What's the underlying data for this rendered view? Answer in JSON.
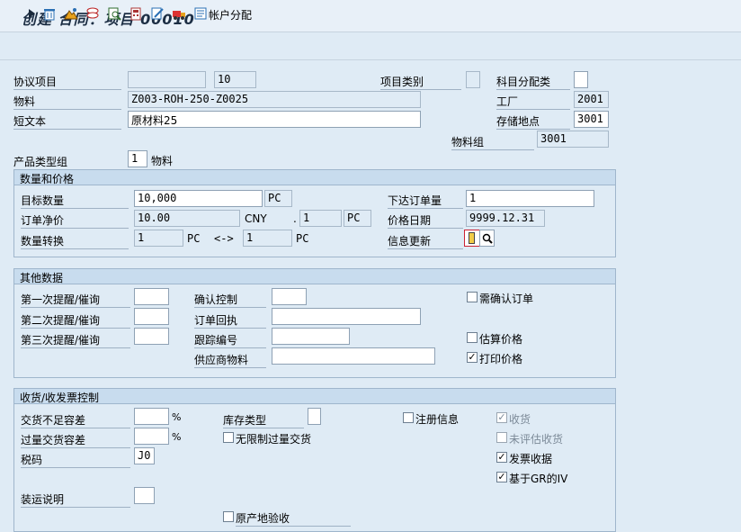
{
  "window": {
    "title": "创建 合同：项目 00010"
  },
  "toolbar": {
    "account_assign_label": "帐户分配"
  },
  "header": {
    "agreement_item_label": "协议项目",
    "agreement_item_value": "10",
    "item_category_label": "项目类别",
    "acct_assign_cat_label": "科目分配类",
    "material_label": "物料",
    "material_value": "Z003-ROH-250-Z0025",
    "plant_label": "工厂",
    "plant_value": "2001",
    "short_text_label": "短文本",
    "short_text_value": "原材料25",
    "storage_loc_label": "存储地点",
    "storage_loc_value": "3001",
    "material_group_label": "物料组",
    "material_group_value": "3001",
    "product_type_label": "产品类型组",
    "product_type_value": "1",
    "product_type_text": "物料"
  },
  "qty_price": {
    "title": "数量和价格",
    "target_qty_label": "目标数量",
    "target_qty_value": "10,000",
    "target_qty_unit": "PC",
    "order_price_label": "订单净价",
    "order_price_value": "10.00",
    "currency": "CNY",
    "per_dot": ".",
    "per_value": "1",
    "per_unit": "PC",
    "conversion_label": "数量转换",
    "conv_left_value": "1",
    "conv_left_unit": "PC",
    "conv_arrow": "<->",
    "conv_right_value": "1",
    "conv_right_unit": "PC",
    "release_order_label": "下达订单量",
    "release_order_value": "1",
    "price_date_label": "价格日期",
    "price_date_value": "9999.12.31",
    "info_update_label": "信息更新"
  },
  "misc": {
    "title": "其他数据",
    "reminder1_label": "第一次提醒/催询",
    "reminder2_label": "第二次提醒/催询",
    "reminder3_label": "第三次提醒/催询",
    "conf_control_label": "确认控制",
    "order_ack_label": "订单回执",
    "tracking_label": "跟踪编号",
    "vendor_material_label": "供应商物料",
    "ack_required_label": "需确认订单",
    "est_price_label": "估算价格",
    "print_price_label": "打印价格"
  },
  "gr": {
    "title": "收货/收发票控制",
    "under_tol_label": "交货不足容差",
    "over_tol_label": "过量交货容差",
    "pct": "%",
    "stock_type_label": "库存类型",
    "unlimited_over_label": "无限制过量交货",
    "tax_code_label": "税码",
    "tax_code_value": "J0",
    "shipping_instr_label": "装运说明",
    "register_info_label": "注册信息",
    "gr_label": "收货",
    "non_val_gr_label": "未评估收货",
    "inv_receipt_label": "发票收据",
    "gr_based_iv_label": "基于GR的IV",
    "origin_insp_label": "原产地验收",
    "check_mark": "✓"
  }
}
